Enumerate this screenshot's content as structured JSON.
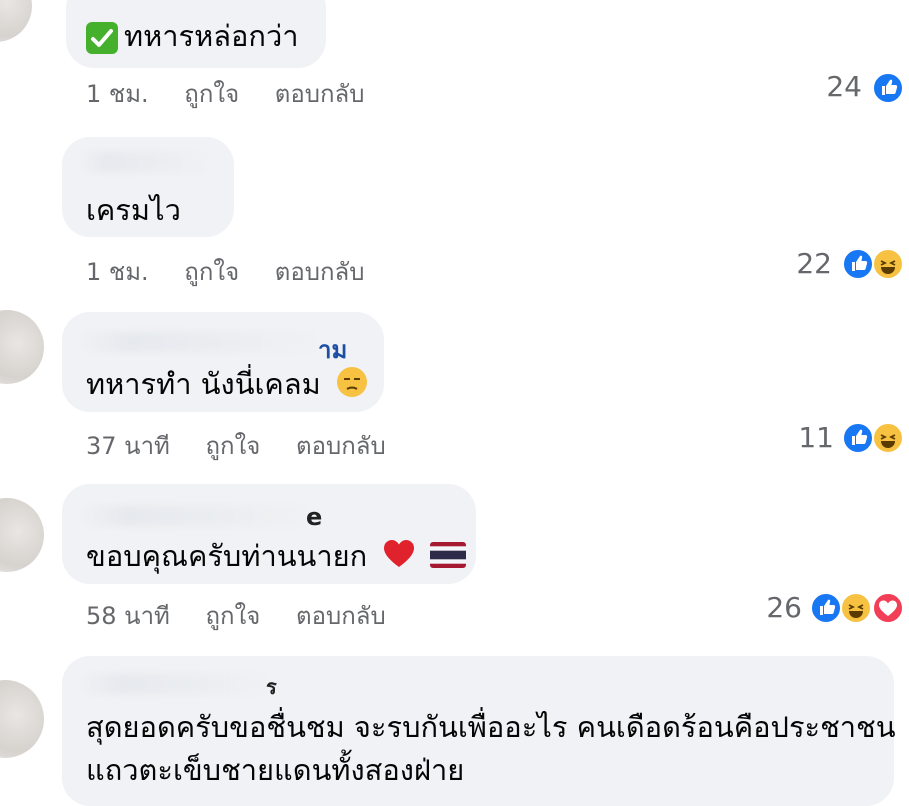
{
  "comments": [
    {
      "text": "ทหารหล่อกว่า",
      "time": "1 ชม.",
      "like_label": "ถูกใจ",
      "reply_label": "ตอบกลับ",
      "reaction_count": "24",
      "reactions": [
        "like-icon"
      ]
    },
    {
      "text": "เครมไว",
      "time": "1 ชม.",
      "like_label": "ถูกใจ",
      "reply_label": "ตอบกลับ",
      "reaction_count": "22",
      "reactions": [
        "like-icon",
        "haha-icon"
      ]
    },
    {
      "author_fragment": "าม",
      "text": "ทหารทำ นังนี่เคลม",
      "time": "37 นาที",
      "like_label": "ถูกใจ",
      "reply_label": "ตอบกลับ",
      "reaction_count": "11",
      "reactions": [
        "like-icon",
        "haha-icon"
      ]
    },
    {
      "author_fragment": "e",
      "text": "ขอบคุณครับท่านนายก",
      "time": "58 นาที",
      "like_label": "ถูกใจ",
      "reply_label": "ตอบกลับ",
      "reaction_count": "26",
      "reactions": [
        "like-icon",
        "haha-icon",
        "love-icon"
      ]
    },
    {
      "author_fragment": "ร",
      "text_line1": "สุดยอดครับขอชื่นชม จะรบกันเพื่ออะไร คนเดือดร้อนคือประชาชน",
      "text_line2": "แถวตะเข็บชายแดนทั้งสองฝ่าย"
    }
  ],
  "colors": {
    "bubble": "#f0f2f5",
    "meta_text": "#65676b",
    "like_blue": "#1877f2",
    "haha_yellow": "#f7c242",
    "love_red": "#f33e58",
    "check_green": "#44b02b"
  }
}
